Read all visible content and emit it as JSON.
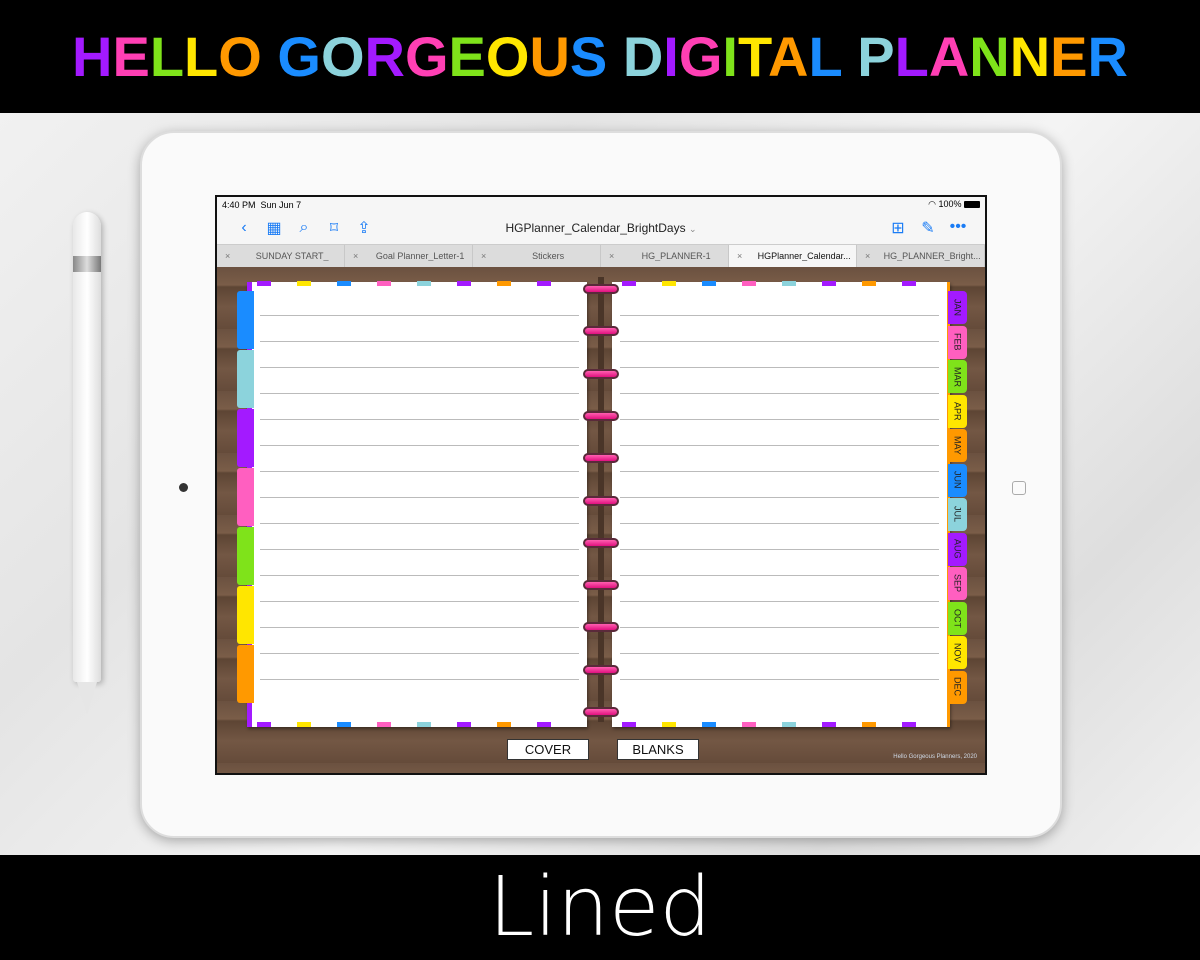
{
  "banner": {
    "title": "HELLO GORGEOUS DIGITAL PLANNER",
    "colors": [
      "#a31aff",
      "#ff3fb4",
      "#7fe31a",
      "#ffe600",
      "#ff9900",
      "#1a8cff",
      "#8cd3dc",
      "#a31aff",
      "#ff3fb4",
      "#7fe31a",
      "#ffe600",
      "#ff9900",
      "#1a8cff",
      "#8cd3dc",
      "#a31aff",
      "#ff3fb4",
      "#7fe31a",
      "#ffe600",
      "#ff9900",
      "#1a8cff",
      "#8cd3dc",
      "#a31aff",
      "#ff3fb4",
      "#7fe31a",
      "#ffe600",
      "#ff9900",
      "#1a8cff"
    ]
  },
  "footer": {
    "label": "Lined"
  },
  "status": {
    "time": "4:40 PM",
    "date": "Sun Jun 7",
    "battery": "100%"
  },
  "toolbar": {
    "title": "HGPlanner_Calendar_BrightDays",
    "chevron": "⌄"
  },
  "tabs": [
    {
      "label": "SUNDAY START_",
      "active": false
    },
    {
      "label": "Goal Planner_Letter-1",
      "active": false
    },
    {
      "label": "Stickers",
      "active": false
    },
    {
      "label": "HG_PLANNER-1",
      "active": false
    },
    {
      "label": "HGPlanner_Calendar...",
      "active": true
    },
    {
      "label": "HG_PLANNER_Bright...",
      "active": false
    }
  ],
  "months": [
    "JAN",
    "FEB",
    "MAR",
    "APR",
    "MAY",
    "JUN",
    "JUL",
    "AUG",
    "SEP",
    "OCT",
    "NOV",
    "DEC"
  ],
  "month_colors": [
    "#a31aff",
    "#ff5fc0",
    "#7fe31a",
    "#ffe600",
    "#ff9900",
    "#1a8cff",
    "#8cd3dc",
    "#a31aff",
    "#ff5fc0",
    "#7fe31a",
    "#ffe600",
    "#ff9900"
  ],
  "section_colors": [
    "#1a8cff",
    "#8cd3dc",
    "#a31aff",
    "#ff5fc0",
    "#7fe31a",
    "#ffe600",
    "#ff9900"
  ],
  "nav": {
    "cover": "COVER",
    "blanks": "BLANKS"
  },
  "credit": "Hello Gorgeous Planners, 2020"
}
